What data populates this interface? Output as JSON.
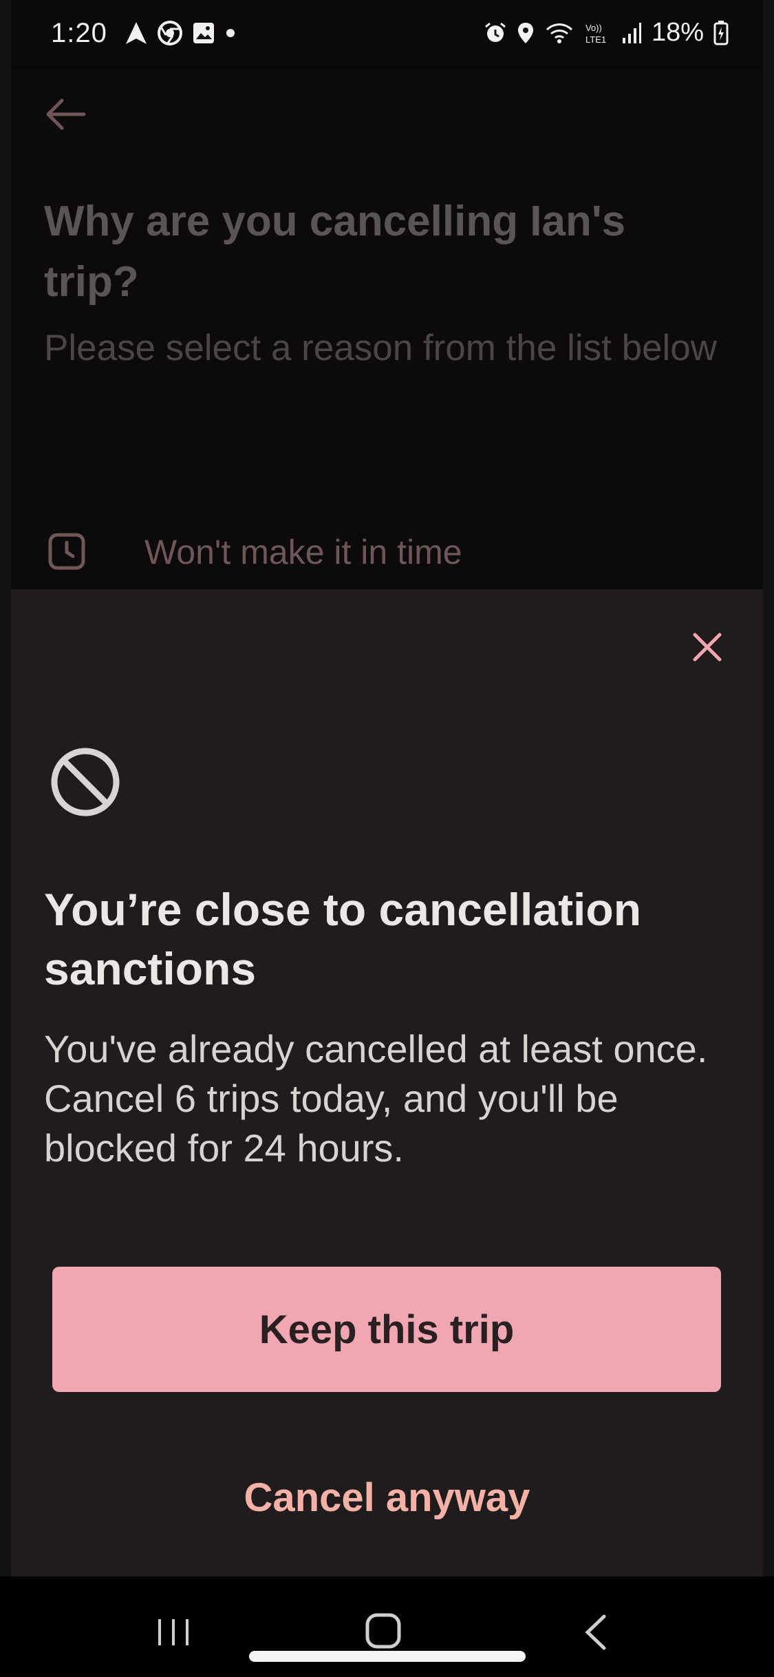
{
  "status_bar": {
    "time": "1:20",
    "battery": "18%",
    "icons_left": [
      "navigation-icon",
      "chrome-icon",
      "gallery-icon",
      "dot-icon"
    ],
    "icons_right": [
      "alarm-icon",
      "location-icon",
      "wifi-icon",
      "volte-icon",
      "signal-icon",
      "battery-charging-icon"
    ]
  },
  "background_page": {
    "title": "Why are you cancelling Ian's trip?",
    "subtitle": "Please select a reason from the list below",
    "reasons": [
      {
        "label": "Won't make it in time",
        "icon": "clock-icon"
      }
    ]
  },
  "sheet": {
    "title": "You’re close to cancellation sanctions",
    "body": "You've already cancelled at least once. Cancel 6 trips today, and you'll be blocked for 24 hours.",
    "primary_button": "Keep this trip",
    "secondary_button": "Cancel anyway"
  },
  "colors": {
    "accent_pink": "#f1a7b2",
    "cancel_text": "#f4b1a6",
    "sheet_bg": "#201b1c",
    "page_bg": "#0c0a0b"
  }
}
